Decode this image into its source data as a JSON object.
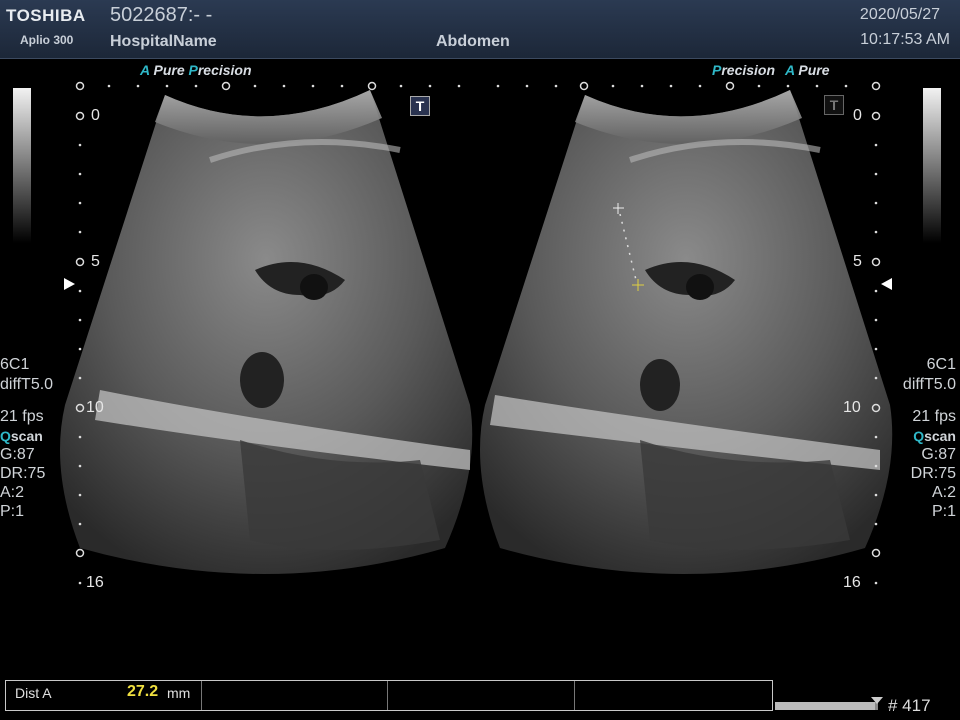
{
  "header": {
    "brand": "TOSHIBA",
    "model": "Aplio 300",
    "patient_id": "5022687:- -",
    "hospital": "HospitalName",
    "exam": "Abdomen",
    "date": "2020/05/27",
    "time": "10:17:53 AM"
  },
  "left_pane": {
    "mode_a": "A",
    "mode_pure": "Pure",
    "mode_p": "P",
    "mode_precision": "recision",
    "t_badge": "T",
    "depth_labels": [
      "0",
      "5",
      "10",
      "16"
    ]
  },
  "right_pane": {
    "mode_p": "P",
    "mode_precision": "recision",
    "mode_a": "A",
    "mode_pure": "Pure",
    "t_badge": "T",
    "depth_labels": [
      "0",
      "5",
      "10",
      "16"
    ]
  },
  "params": {
    "probe": "6C1",
    "preset": "diffT5.0",
    "fps": "21 fps",
    "q": "Q",
    "scan": "scan",
    "gain": "G:87",
    "dr": "DR:75",
    "a": "A:2",
    "p": "P:1"
  },
  "measurement": {
    "label": "Dist A",
    "value": "27.2",
    "unit": "mm"
  },
  "footer": {
    "frame": "# 417",
    "progress": 0.97
  },
  "colors": {
    "accent": "#2fb8c8",
    "measurement_value": "#f0e040"
  }
}
